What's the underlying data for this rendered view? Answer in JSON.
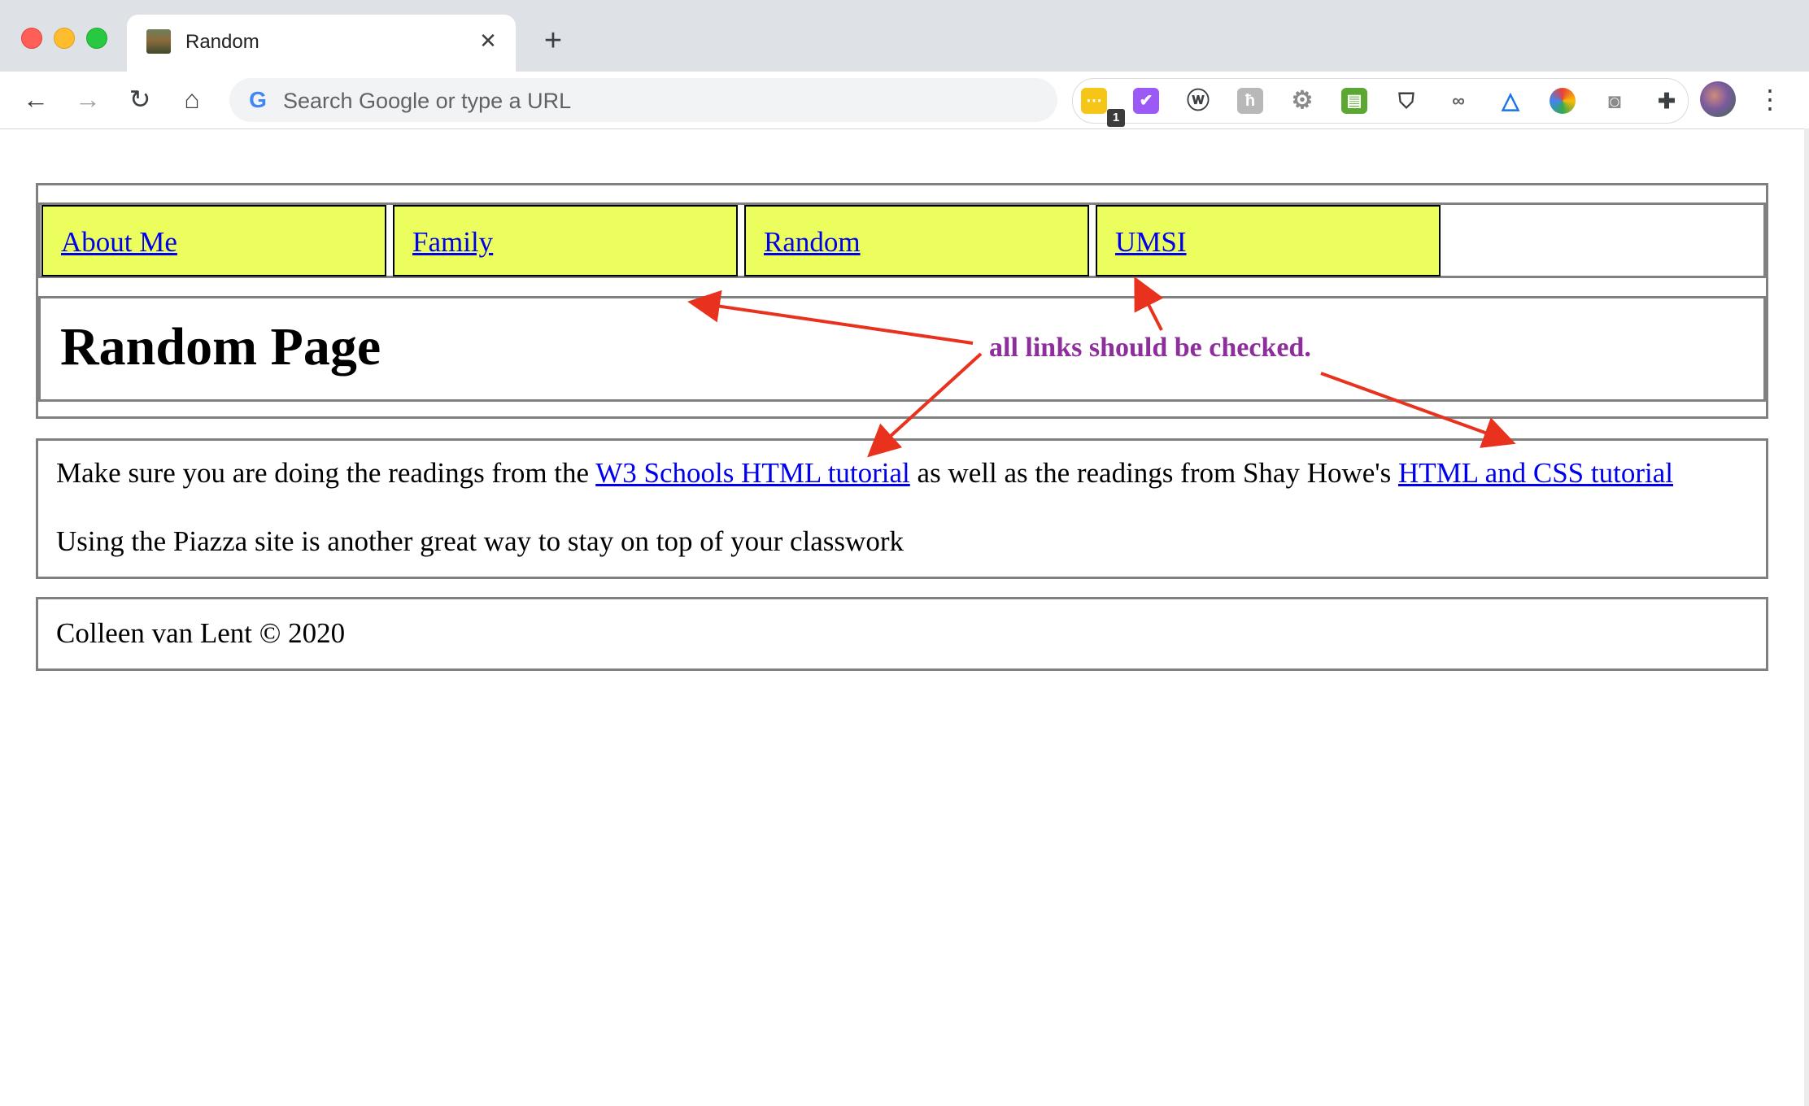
{
  "browser": {
    "tab_title": "Random",
    "tab_close": "✕",
    "new_tab": "+",
    "back": "←",
    "forward": "→",
    "reload": "↻",
    "home": "⌂",
    "google_g": "G",
    "omnibox_placeholder": "Search Google or type a URL",
    "extension_badge": "1",
    "menu": "⋮",
    "extensions": [
      {
        "icon": "sticky-note-icon",
        "color": "#f5c518"
      },
      {
        "icon": "checkmark-task-icon",
        "color": "#9b59f5"
      },
      {
        "icon": "w-logo-icon",
        "color": "#3c4043"
      },
      {
        "icon": "h-logo-icon",
        "color": "#b8b8b8"
      },
      {
        "icon": "gear-icon",
        "color": "#8a8a8a"
      },
      {
        "icon": "printer-icon",
        "color": "#5aa832"
      },
      {
        "icon": "shield-icon",
        "color": "#3c4043"
      },
      {
        "icon": "glasses-icon",
        "color": "#5f6368"
      },
      {
        "icon": "ax-triangle-icon",
        "color": "#1a73e8"
      },
      {
        "icon": "color-wheel-icon",
        "color": "#e94235"
      },
      {
        "icon": "camera-icon",
        "color": "#8a8a8a"
      },
      {
        "icon": "puzzle-icon",
        "color": "#3c4043"
      }
    ]
  },
  "page": {
    "nav": [
      "About Me",
      "Family",
      "Random",
      "UMSI"
    ],
    "title": "Random Page",
    "paragraph1": {
      "before": "Make sure you are doing the readings from the ",
      "link1": "W3 Schools HTML tutorial",
      "middle": " as well as the readings from Shay Howe's ",
      "link2": "HTML and CSS tutorial"
    },
    "paragraph2": "Using the Piazza site is another great way to stay on top of your classwork",
    "footer": "Colleen van Lent © 2020"
  },
  "annotation": {
    "text": "all links should be checked.",
    "color": "#8e2e9c",
    "arrow_color": "#e8321e"
  },
  "colors": {
    "nav_background": "#ebfe5e",
    "link": "#0000ee",
    "border": "#808080"
  }
}
